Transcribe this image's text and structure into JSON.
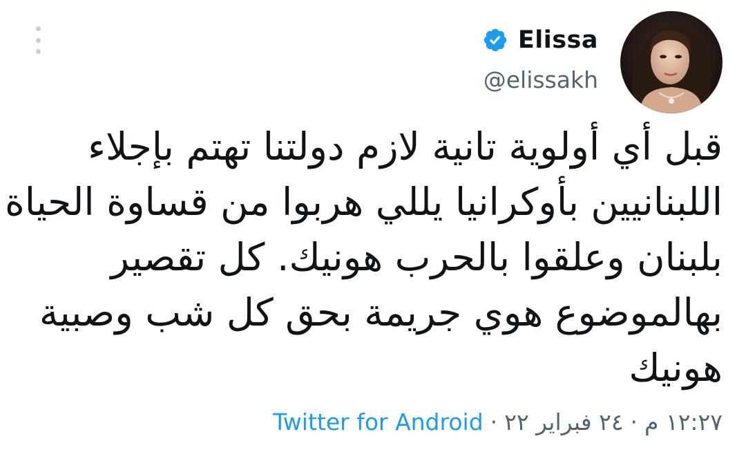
{
  "author": {
    "display_name": "Elissa",
    "handle": "@elissakh",
    "verified": true,
    "verified_badge_color": "#1d9bf0",
    "avatar_icon": "profile-photo"
  },
  "tweet": {
    "lines": [
      "قبل أي أولوية تانية لازم دولتنا تهتم بإجلاء",
      "اللبنانيين بأوكرانيا يللي هربوا من قساوة الحياة",
      "بلبنان وعلقوا بالحرب هونيك. كل تقصير",
      "بهالموضوع هوي جريمة بحق كل شب وصبية",
      "هونيك"
    ],
    "time": "١٢:٢٧ م",
    "date": "٢٤ فبراير ٢٢",
    "separator": "·",
    "source": "Twitter for Android"
  },
  "menu": {
    "icon": "more-vertical-icon"
  },
  "colors": {
    "text_primary": "#0f1419",
    "text_secondary": "#536471",
    "link": "#1d9bf0",
    "background": "#ffffff"
  }
}
